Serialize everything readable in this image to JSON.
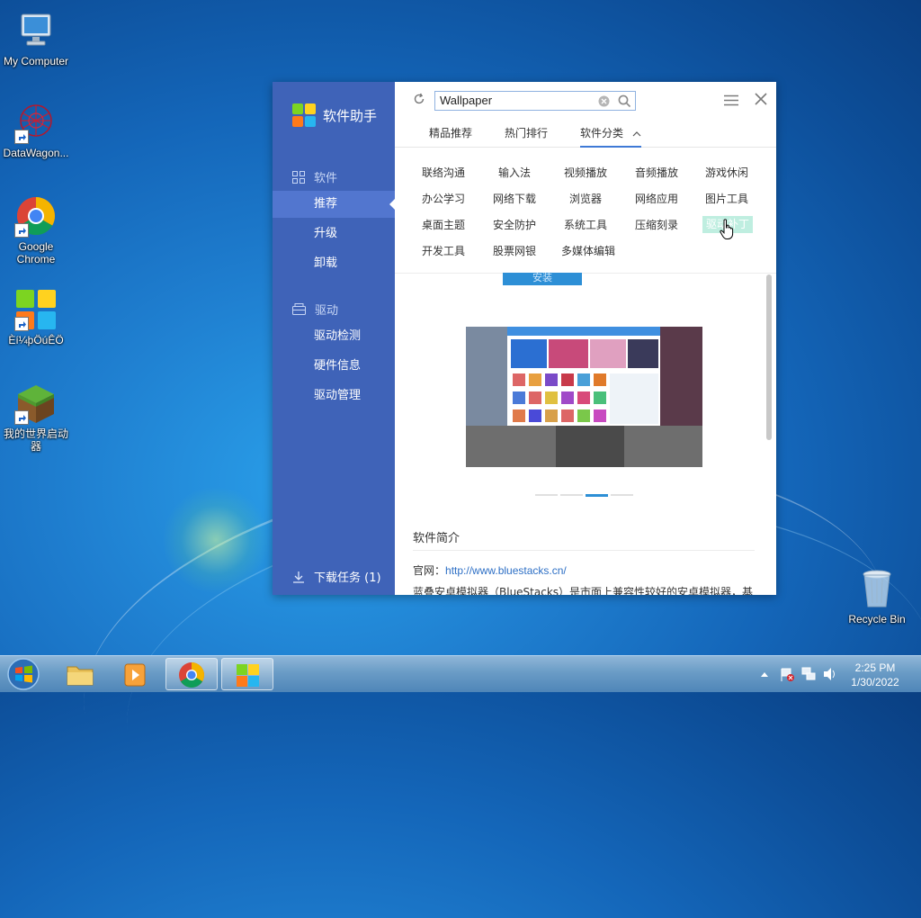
{
  "desktop": {
    "icons": [
      {
        "label": "My Computer"
      },
      {
        "label": "DataWagon..."
      },
      {
        "label": "Google Chrome"
      },
      {
        "label": "Èí¼þÖúÊÖ"
      },
      {
        "label": "我的世界启动器"
      },
      {
        "label": "Recycle Bin"
      }
    ]
  },
  "app": {
    "brand": "软件助手",
    "sidebar": {
      "software_header": "软件",
      "software_items": [
        "推荐",
        "升级",
        "卸载"
      ],
      "driver_header": "驱动",
      "driver_items": [
        "驱动检测",
        "硬件信息",
        "驱动管理"
      ],
      "download": "下载任务 (1)"
    },
    "search": {
      "value": "Wallpaper"
    },
    "tabs": [
      "精品推荐",
      "热门排行",
      "软件分类"
    ],
    "active_tab": "软件分类",
    "categories": [
      [
        "联络沟通",
        "输入法",
        "视频播放",
        "音频播放",
        "游戏休闲"
      ],
      [
        "办公学习",
        "网络下载",
        "浏览器",
        "网络应用",
        "图片工具"
      ],
      [
        "桌面主题",
        "安全防护",
        "系统工具",
        "压缩刻录",
        "驱动补丁"
      ],
      [
        "开发工具",
        "股票网银",
        "多媒体编辑"
      ]
    ],
    "hovered_category": "驱动补丁",
    "install_label": "安装",
    "intro_title": "软件简介",
    "site_label": "官网：",
    "site_url": "http://www.bluestacks.cn/",
    "description": "蓝叠安卓模拟器（BlueStacks）是市面上兼容性较好的安卓模拟器，基"
  },
  "taskbar": {
    "time": "2:25 PM",
    "date": "1/30/2022"
  },
  "colors": {
    "sidebar": "#3f63b8",
    "sidebar_active": "#5276cf",
    "accent": "#2d8fd6"
  }
}
